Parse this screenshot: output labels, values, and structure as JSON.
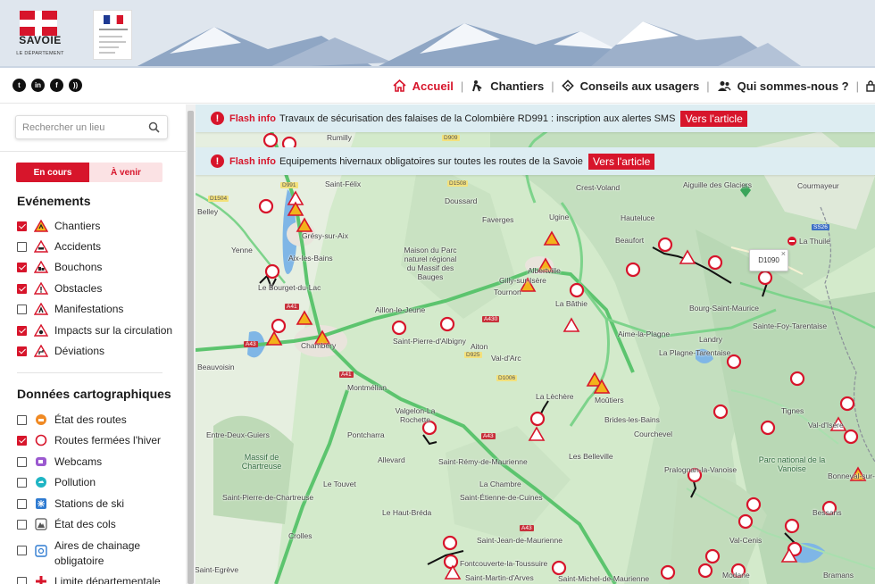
{
  "header": {
    "logo_text": "SAVOIE",
    "logo_subtext": "LE DÉPARTEMENT",
    "prefet_logo_text": "PRÉFET DE LA RÉGION",
    "social": [
      "twitter-icon",
      "linkedin-icon",
      "facebook-icon",
      "rss-icon"
    ],
    "nav": [
      {
        "label": "Accueil",
        "icon": "home-icon",
        "active": true
      },
      {
        "label": "Chantiers",
        "icon": "worker-icon",
        "active": false
      },
      {
        "label": "Conseils aux usagers",
        "icon": "diamond-sign-icon",
        "active": false
      },
      {
        "label": "Qui sommes-nous ?",
        "icon": "people-icon",
        "active": false
      }
    ],
    "accent": "#d7152b"
  },
  "sidebar": {
    "search_placeholder": "Rechercher un lieu",
    "tabs": {
      "current": "En cours",
      "upcoming": "À venir"
    },
    "events_title": "Evénements",
    "events": [
      {
        "label": "Chantiers",
        "checked": true,
        "icon": "roadwork-icon"
      },
      {
        "label": "Accidents",
        "checked": false,
        "icon": "accident-icon"
      },
      {
        "label": "Bouchons",
        "checked": true,
        "icon": "traffic-jam-icon"
      },
      {
        "label": "Obstacles",
        "checked": true,
        "icon": "obstacle-icon"
      },
      {
        "label": "Manifestations",
        "checked": false,
        "icon": "event-icon"
      },
      {
        "label": "Impacts sur la circulation",
        "checked": true,
        "icon": "traffic-impact-icon"
      },
      {
        "label": "Déviations",
        "checked": true,
        "icon": "detour-icon"
      }
    ],
    "map_data_title": "Données cartographiques",
    "map_data": [
      {
        "label": "État des routes",
        "checked": false,
        "icon": "road-state-icon"
      },
      {
        "label": "Routes fermées l'hiver",
        "checked": true,
        "icon": "closed-road-icon"
      },
      {
        "label": "Webcams",
        "checked": false,
        "icon": "webcam-icon"
      },
      {
        "label": "Pollution",
        "checked": false,
        "icon": "pollution-icon"
      },
      {
        "label": "Stations de ski",
        "checked": false,
        "icon": "ski-station-icon"
      },
      {
        "label": "État des cols",
        "checked": false,
        "icon": "mountain-pass-icon"
      },
      {
        "label": "Aires de chainage obligatoire",
        "checked": false,
        "icon": "chain-area-icon"
      },
      {
        "label": "Limite départementale",
        "checked": false,
        "icon": "boundary-icon"
      }
    ]
  },
  "map": {
    "flash": [
      {
        "label": "Flash info",
        "text": "Travaux de sécurisation des falaises de la Colombière RD991 : inscription aux alertes SMS",
        "button": "Vers l'article"
      },
      {
        "label": "Flash info",
        "text": "Equipements hivernaux obligatoires sur toutes les routes de la Savoie",
        "button": "Vers l'article"
      }
    ],
    "popup": "D1090",
    "places": [
      "Rumilly",
      "Saint-Félix",
      "Doussard",
      "Crest-Voland",
      "Aiguille des Glaciers",
      "Courmayeur",
      "Belley",
      "Grésy-sur-Aix",
      "Faverges",
      "Ugine",
      "Hauteluce",
      "La Thuile",
      "Yenne",
      "Aix-les-Bains",
      "Maison du Parc naturel régional du Massif des Bauges",
      "Beaufort",
      "Le Bourget-du-Lac",
      "Albertville",
      "Gilly-sur-Isère",
      "Tournon",
      "Aillon-le-Jeune",
      "La Bâthie",
      "Bourg-Saint-Maurice",
      "Sainte-Foy-Tarentaise",
      "Chambéry",
      "Saint-Pierre-d'Albigny",
      "Aiton",
      "Aime-la-Plagne",
      "Landry",
      "Val-d'Arc",
      "La Plagne-Tarentaise",
      "Beauvoisin",
      "Montmélian",
      "La Lèchère",
      "Moûtiers",
      "Tignes",
      "Valgelon-La Rochette",
      "Brides-les-Bains",
      "Val-d'Isère",
      "Entre-Deux-Guiers",
      "Pontcharra",
      "Courchevel",
      "Allevard",
      "Saint-Rémy-de-Maurienne",
      "Les Belleville",
      "Massif de Chartreuse",
      "Parc national de la Vanoise",
      "Pralognan-la-Vanoise",
      "Bonneval-sur-Arc",
      "Le Touvet",
      "La Chambre",
      "Saint-Pierre-de-Chartreuse",
      "Saint-Étienne-de-Cuines",
      "Le Haut-Bréda",
      "Bessans",
      "Crolles",
      "Saint-Jean-de-Maurienne",
      "Val-Cenis",
      "Saint-Egrève",
      "Fontcouverte-la-Toussuire",
      "Saint-Martin-d'Arves",
      "Saint-Michel-de-Maurienne",
      "Modane",
      "Bramans"
    ],
    "roads": [
      "D909",
      "D1508",
      "D1504",
      "D991",
      "A41",
      "A43",
      "A430",
      "D925",
      "D1006",
      "A41",
      "A43",
      "A43",
      "SS26"
    ]
  }
}
